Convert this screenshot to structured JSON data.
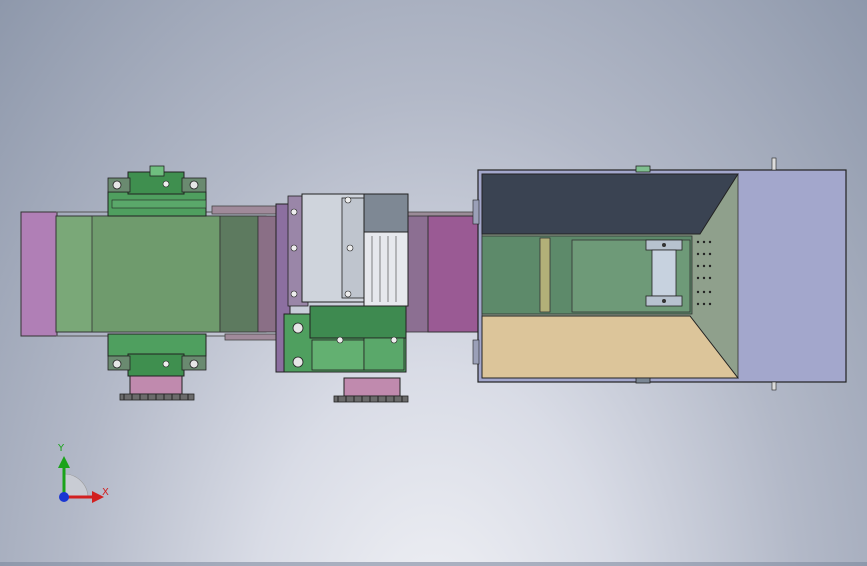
{
  "viewport": {
    "view": "Top",
    "background": [
      "#8e98ab",
      "#f1f2f6"
    ]
  },
  "model": {
    "components": [
      "left-drive-gearbox",
      "left-sprocket",
      "conveyor-belt",
      "gear-motor",
      "right-sprocket",
      "hopper-housing",
      "roller-shaft"
    ],
    "colors": {
      "belt_green": "#7aa878",
      "end_pink": "#b07fb6",
      "gearbox_green": "#4f9f5f",
      "sprocket_pink": "#c08aae",
      "motor_gray": "#cfd4dc",
      "hopper_blue": "#a3a7cc",
      "hopper_dark": "#3a4352",
      "hopper_tan": "#dcc59a",
      "interior_green": "#5d8a6a"
    }
  },
  "triad": {
    "x_label": "X",
    "y_label": "Y",
    "x_color": "#d22020",
    "y_color": "#1aa31a",
    "z_color": "#1a36d2"
  }
}
